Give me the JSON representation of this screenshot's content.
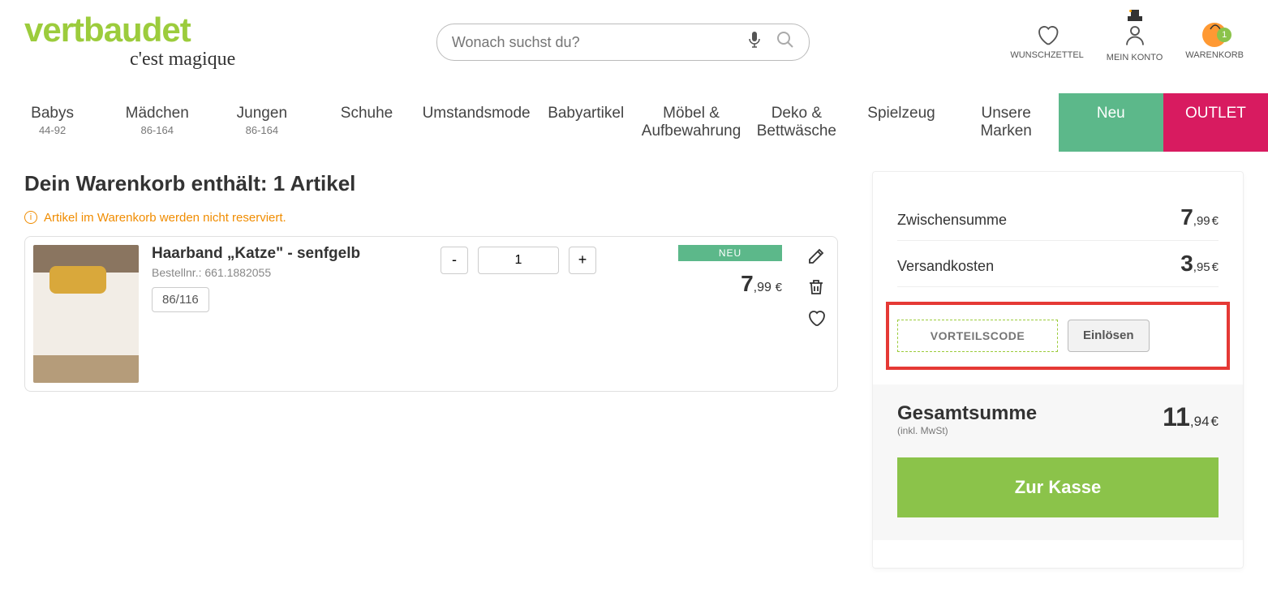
{
  "logo": {
    "main": "vertbaudet",
    "sub": "c'est magique"
  },
  "search": {
    "placeholder": "Wonach suchst du?"
  },
  "headerIcons": {
    "wishlist": "WUNSCHZETTEL",
    "account": "MEIN KONTO",
    "cart": "WARENKORB",
    "cartCount": "1"
  },
  "nav": [
    {
      "label": "Babys",
      "sub": "44-92"
    },
    {
      "label": "Mädchen",
      "sub": "86-164"
    },
    {
      "label": "Jungen",
      "sub": "86-164"
    },
    {
      "label": "Schuhe",
      "sub": ""
    },
    {
      "label": "Umstandsmode",
      "sub": ""
    },
    {
      "label": "Babyartikel",
      "sub": ""
    },
    {
      "label": "Möbel & Aufbewahrung",
      "sub": ""
    },
    {
      "label": "Deko & Bettwäsche",
      "sub": ""
    },
    {
      "label": "Spielzeug",
      "sub": ""
    },
    {
      "label": "Unsere Marken",
      "sub": ""
    },
    {
      "label": "Neu",
      "sub": ""
    },
    {
      "label": "OUTLET",
      "sub": ""
    }
  ],
  "cart": {
    "titleBold": "Dein Warenkorb enthält:",
    "titleCount": "1 Artikel",
    "notice": "Artikel im Warenkorb werden nicht reserviert.",
    "item": {
      "name": "Haarband „Katze\" - senfgelb",
      "skuLabel": "Bestellnr.: 661.1882055",
      "size": "86/116",
      "qty": "1",
      "badge": "NEU",
      "priceBig": "7",
      "priceSm": ",99",
      "priceCur": "€"
    }
  },
  "summary": {
    "subtotal": {
      "label": "Zwischensumme",
      "big": "7",
      "sm": ",99",
      "cur": "€"
    },
    "shipping": {
      "label": "Versandkosten",
      "big": "3",
      "sm": ",95",
      "cur": "€"
    },
    "promoPlaceholder": "VORTEILSCODE",
    "promoBtn": "Einlösen",
    "totalLabel": "Gesamtsumme",
    "totalSub": "(inkl. MwSt)",
    "totalBig": "11",
    "totalSm": ",94",
    "totalCur": "€",
    "checkout": "Zur Kasse"
  }
}
